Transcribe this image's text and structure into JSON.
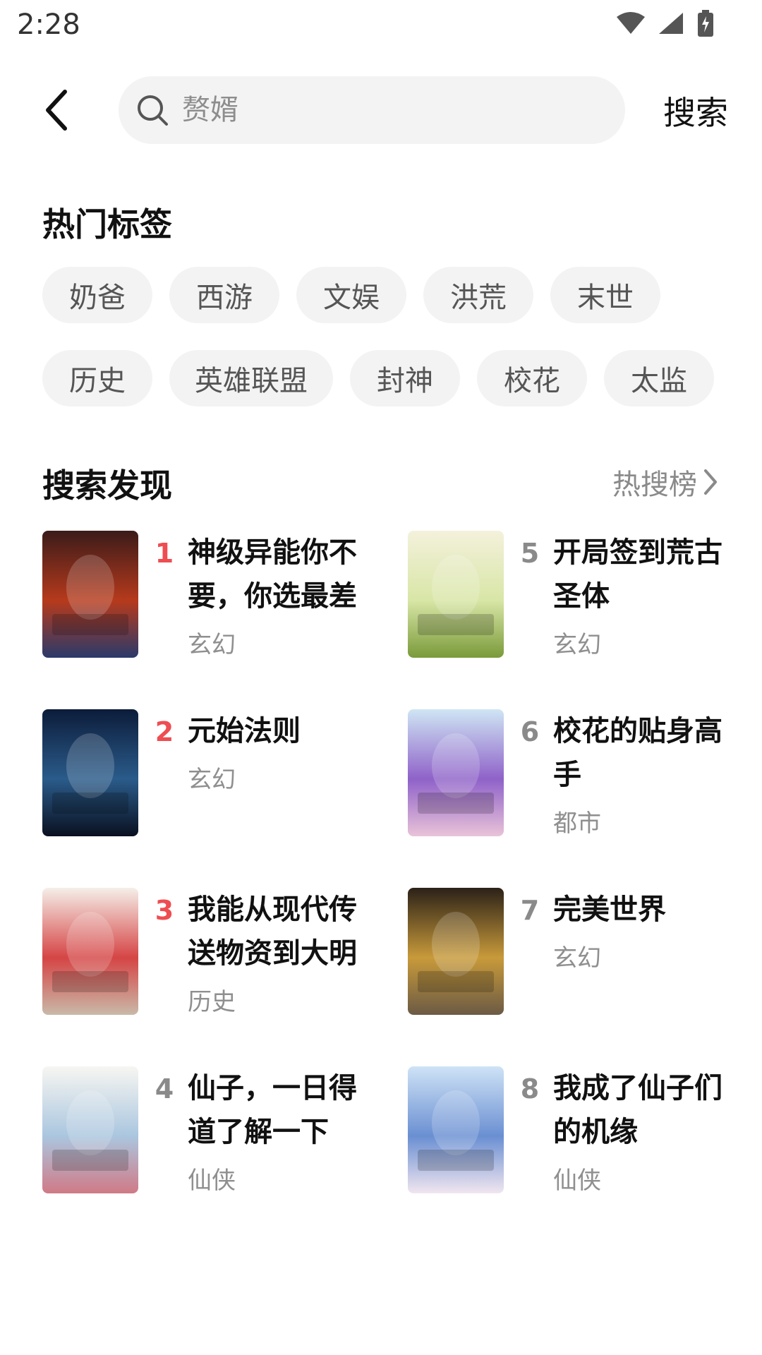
{
  "status_bar": {
    "time": "2:28"
  },
  "search": {
    "placeholder": "赘婿",
    "action_label": "搜索"
  },
  "hot_tags": {
    "title": "热门标签",
    "items": [
      "奶爸",
      "西游",
      "文娱",
      "洪荒",
      "末世",
      "历史",
      "英雄联盟",
      "封神",
      "校花",
      "太监"
    ]
  },
  "discover": {
    "title": "搜索发现",
    "hot_link": "热搜榜",
    "books": [
      {
        "rank": "1",
        "title": "神级异能你不要，你选最差",
        "genre": "玄幻",
        "cover_colors": [
          "#3b1b1a",
          "#b63a1c",
          "#2a3a6a"
        ]
      },
      {
        "rank": "5",
        "title": "开局签到荒古圣体",
        "genre": "玄幻",
        "cover_colors": [
          "#f4f1dc",
          "#d8e6a6",
          "#7a9a3a"
        ]
      },
      {
        "rank": "2",
        "title": "元始法则",
        "genre": "玄幻",
        "cover_colors": [
          "#0c1c3a",
          "#2a5b8a",
          "#0a1020"
        ]
      },
      {
        "rank": "6",
        "title": "校花的贴身高手",
        "genre": "都市",
        "cover_colors": [
          "#cfe6f4",
          "#8f62c9",
          "#e9c3d8"
        ]
      },
      {
        "rank": "3",
        "title": "我能从现代传送物资到大明",
        "genre": "历史",
        "cover_colors": [
          "#f5efe9",
          "#d54545",
          "#c9b9a8"
        ]
      },
      {
        "rank": "7",
        "title": "完美世界",
        "genre": "玄幻",
        "cover_colors": [
          "#2b2118",
          "#c89a3a",
          "#6b5a44"
        ]
      },
      {
        "rank": "4",
        "title": "仙子，一日得道了解一下",
        "genre": "仙侠",
        "cover_colors": [
          "#f7f6f2",
          "#aac6df",
          "#d07a86"
        ]
      },
      {
        "rank": "8",
        "title": "我成了仙子们的机缘",
        "genre": "仙侠",
        "cover_colors": [
          "#cfe3f6",
          "#6a8fd2",
          "#f1e6ef"
        ]
      }
    ]
  },
  "colors": {
    "rank_top": "#ee4d52",
    "rank_normal": "#8a8a8a",
    "tag_bg": "#f3f3f3"
  }
}
